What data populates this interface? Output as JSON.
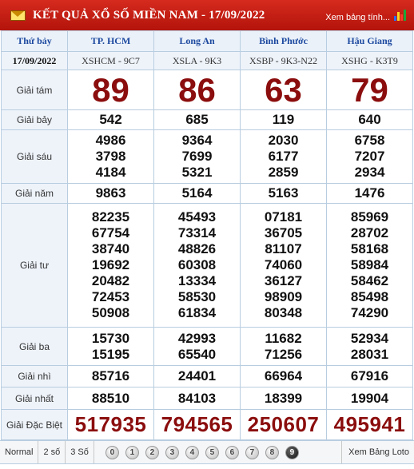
{
  "header": {
    "title": "KẾT QUẢ XỔ SỐ MIỀN NAM - 17/09/2022",
    "view_link": "Xem bảng tính...",
    "envelope_icon": "envelope-icon",
    "chart_icon": "bar-chart-icon",
    "colors": {
      "header_bg": "#c4180f",
      "big_number": "#8b0d0d",
      "province": "#1e4aa0"
    }
  },
  "table": {
    "day": "Thứ bảy",
    "date": "17/09/2022",
    "provinces": [
      "TP. HCM",
      "Long An",
      "Bình Phước",
      "Hậu Giang"
    ],
    "codes": [
      "XSHCM - 9C7",
      "XSLA - 9K3",
      "XSBP - 9K3-N22",
      "XSHG - K3T9"
    ],
    "prizes": [
      {
        "label": "Giải tám",
        "values": [
          [
            "89"
          ],
          [
            "86"
          ],
          [
            "63"
          ],
          [
            "79"
          ]
        ]
      },
      {
        "label": "Giải bảy",
        "values": [
          [
            "542"
          ],
          [
            "685"
          ],
          [
            "119"
          ],
          [
            "640"
          ]
        ]
      },
      {
        "label": "Giải sáu",
        "values": [
          [
            "4986",
            "3798",
            "4184"
          ],
          [
            "9364",
            "7699",
            "5321"
          ],
          [
            "2030",
            "6177",
            "2859"
          ],
          [
            "6758",
            "7207",
            "2934"
          ]
        ]
      },
      {
        "label": "Giải năm",
        "values": [
          [
            "9863"
          ],
          [
            "5164"
          ],
          [
            "5163"
          ],
          [
            "1476"
          ]
        ]
      },
      {
        "label": "Giải tư",
        "values": [
          [
            "82235",
            "67754",
            "38740",
            "19692",
            "20482",
            "72453",
            "50908"
          ],
          [
            "45493",
            "73314",
            "48826",
            "60308",
            "13334",
            "58530",
            "61834"
          ],
          [
            "07181",
            "36705",
            "81107",
            "74060",
            "36127",
            "98909",
            "80348"
          ],
          [
            "85969",
            "28702",
            "58168",
            "58984",
            "58462",
            "85498",
            "74290"
          ]
        ]
      },
      {
        "label": "Giải ba",
        "values": [
          [
            "15730",
            "15195"
          ],
          [
            "42993",
            "65540"
          ],
          [
            "11682",
            "71256"
          ],
          [
            "52934",
            "28031"
          ]
        ]
      },
      {
        "label": "Giải nhì",
        "values": [
          [
            "85716"
          ],
          [
            "24401"
          ],
          [
            "66964"
          ],
          [
            "67916"
          ]
        ]
      },
      {
        "label": "Giải nhất",
        "values": [
          [
            "88510"
          ],
          [
            "84103"
          ],
          [
            "18399"
          ],
          [
            "19904"
          ]
        ]
      },
      {
        "label": "Giải Đặc Biệt",
        "values": [
          [
            "517935"
          ],
          [
            "794565"
          ],
          [
            "250607"
          ],
          [
            "495941"
          ]
        ]
      }
    ]
  },
  "footer": {
    "normal": "Normal",
    "two": "2 số",
    "three": "3 Số",
    "digits": [
      "0",
      "1",
      "2",
      "3",
      "4",
      "5",
      "6",
      "7",
      "8",
      "9"
    ],
    "loto_link": "Xem Bảng Loto"
  }
}
